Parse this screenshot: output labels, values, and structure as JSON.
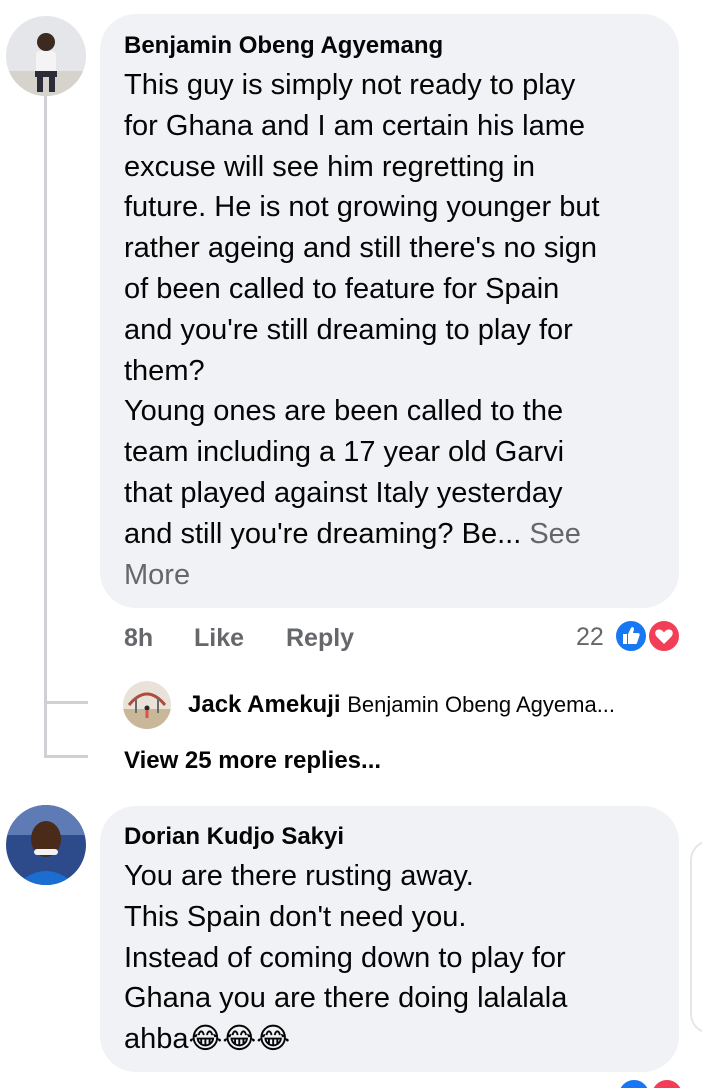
{
  "comments": [
    {
      "author": "Benjamin Obeng Agyemang",
      "avatar_icon": "person-avatar-icon",
      "text": "This guy is simply not ready to play\nfor Ghana and I am certain his lame\nexcuse will see him regretting in\nfuture. He is not growing younger but\nrather ageing and still there's no sign\nof been called to feature for Spain\nand you're still dreaming to play for\nthem?\nYoung ones are been called to the\nteam including a 17 year old Garvi\nthat played against Italy yesterday\nand still you're dreaming? Be... ",
      "see_more": "See\nMore",
      "time": "8h",
      "like_label": "Like",
      "reply_label": "Reply",
      "reaction_count": "22",
      "reactions": [
        "like-reaction-icon",
        "love-reaction-icon"
      ],
      "replies": [
        {
          "author": "Jack Amekuji",
          "preview": "Benjamin Obeng Agyema..."
        }
      ],
      "view_more_replies": "View 25 more replies..."
    },
    {
      "author": "Dorian Kudjo Sakyi",
      "avatar_icon": "person-avatar-icon",
      "text": "You are there rusting away.\nThis Spain don't need you.\nInstead of coming down to play for\nGhana you are there doing lalalala\nahba",
      "emojis": "😂😂😂"
    }
  ],
  "colors": {
    "bubble": "#f0f2f5",
    "secondary_text": "#65676b",
    "like_blue": "#1877f2",
    "love_red": "#f33e58"
  }
}
